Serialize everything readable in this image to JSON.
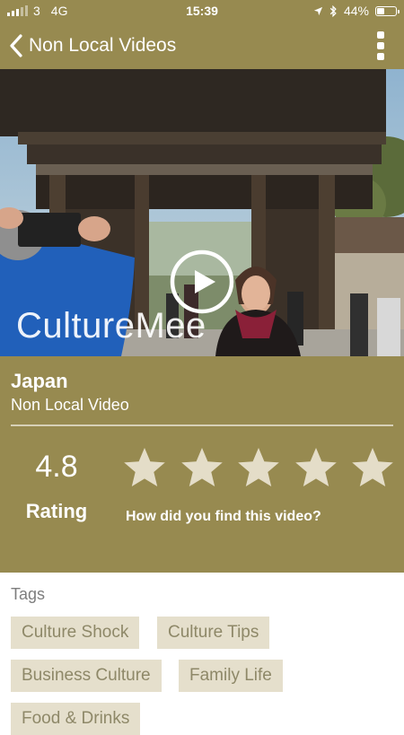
{
  "status_bar": {
    "signal_bars": "3",
    "network": "4G",
    "time": "15:39",
    "battery_percent": "44%",
    "battery_level": 0.44,
    "icons": [
      "signal-icon",
      "location-arrow-icon",
      "bluetooth-icon",
      "battery-icon"
    ]
  },
  "header": {
    "title": "Non Local Videos",
    "back_icon": "chevron-left-icon",
    "menu_icon": "more-vertical-icon"
  },
  "video": {
    "watermark": "CultureMee",
    "play_icon": "play-icon"
  },
  "info": {
    "country": "Japan",
    "video_type": "Non Local Video"
  },
  "rating": {
    "value": "4.8",
    "label": "Rating",
    "stars_total": 5,
    "prompt": "How did you find this video?"
  },
  "tags": {
    "heading": "Tags",
    "items": [
      "Culture Shock",
      "Culture Tips",
      "Business Culture",
      "Family Life",
      "Food & Drinks"
    ]
  },
  "colors": {
    "brand": "#978a50",
    "tag_background": "#e5dfcc",
    "tag_text": "#8e8868",
    "star": "#e4ddc8"
  }
}
